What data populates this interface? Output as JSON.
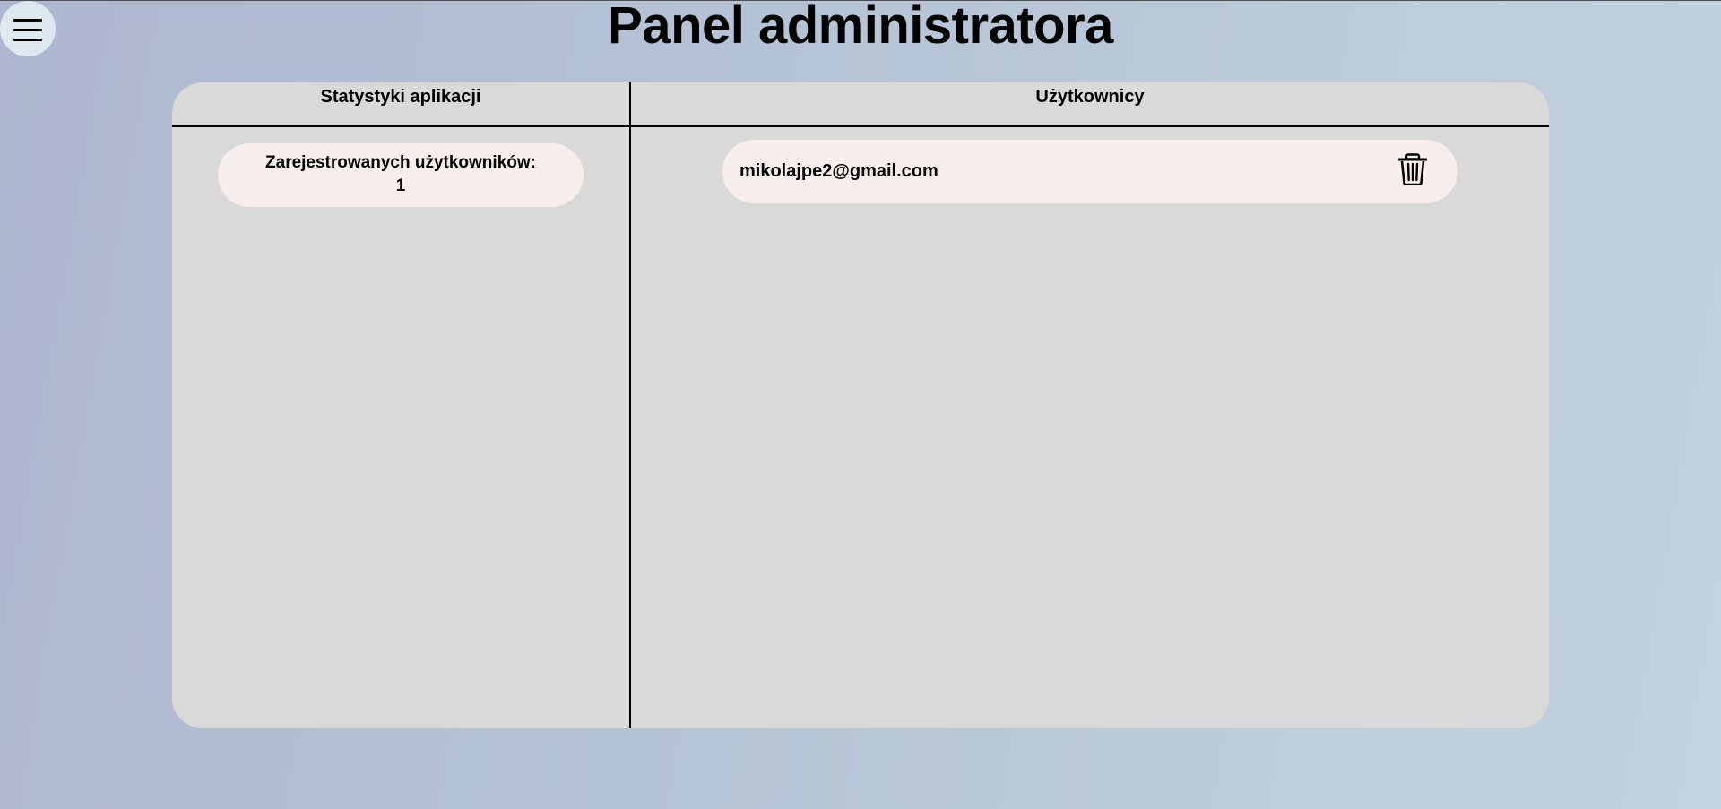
{
  "header": {
    "title": "Panel administratora",
    "menu_icon": "hamburger-menu-icon"
  },
  "stats": {
    "heading": "Statystyki aplikacji",
    "registered_label": "Zarejestrowanych użytkowników:",
    "registered_value": "1"
  },
  "users": {
    "heading": "Użytkownicy",
    "delete_icon": "trash-icon",
    "items": [
      {
        "email": "mikolajpe2@gmail.com"
      }
    ]
  },
  "colors": {
    "panel_bg": "#d9d9d9",
    "card_bg": "#f8eded",
    "menu_button_bg": "#dde9ef"
  }
}
